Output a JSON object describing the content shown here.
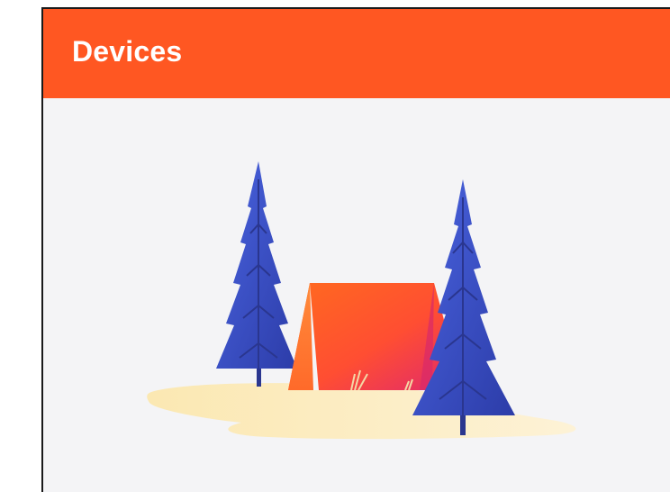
{
  "header": {
    "title": "Devices"
  },
  "illustration": {
    "name": "empty-state-camping-illustration"
  },
  "colors": {
    "app_bar": "#ff5722",
    "background": "#f4f4f6",
    "title_text": "#ffffff",
    "tree": "#3a4fbf",
    "tent_light": "#ff7a28",
    "tent_dark": "#e8326a",
    "ground": "#fbe9b9"
  }
}
